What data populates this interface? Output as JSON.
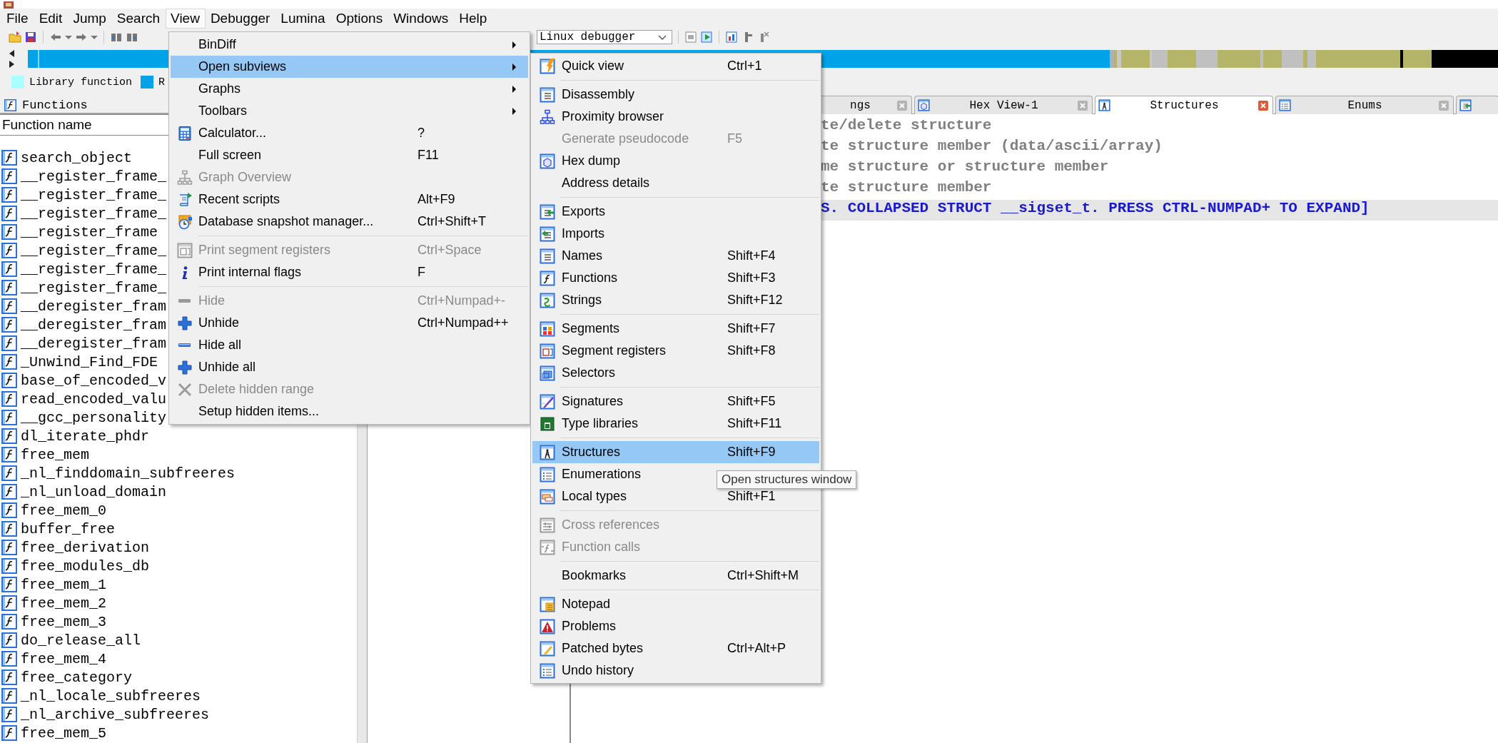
{
  "menu_bar": [
    {
      "label": "File",
      "selected": false
    },
    {
      "label": "Edit",
      "selected": false
    },
    {
      "label": "Jump",
      "selected": false
    },
    {
      "label": "Search",
      "selected": false
    },
    {
      "label": "View",
      "selected": true
    },
    {
      "label": "Debugger",
      "selected": false
    },
    {
      "label": "Lumina",
      "selected": false
    },
    {
      "label": "Options",
      "selected": false
    },
    {
      "label": "Windows",
      "selected": false
    },
    {
      "label": "Help",
      "selected": false
    }
  ],
  "toolbar": {
    "debugger": "Linux debugger"
  },
  "legend": [
    {
      "label": "Library function",
      "color": "#aaffff"
    },
    {
      "label": "R",
      "color": "#00a2e8"
    }
  ],
  "functions_panel": {
    "title": "Functions",
    "column": "Function name",
    "rows": [
      "search_object",
      "__register_frame_",
      "__register_frame_",
      "__register_frame_",
      "__register_frame",
      "__register_frame_",
      "__register_frame_",
      "__register_frame_",
      "__deregister_fram",
      "__deregister_fram",
      "__deregister_fram",
      "_Unwind_Find_FDE",
      "base_of_encoded_v",
      "read_encoded_valu",
      "__gcc_personality",
      "dl_iterate_phdr",
      "free_mem",
      "_nl_finddomain_subfreeres",
      "_nl_unload_domain",
      "free_mem_0",
      "buffer_free",
      "free_derivation",
      "free_modules_db",
      "free_mem_1",
      "free_mem_2",
      "free_mem_3",
      "do_release_all",
      "free_mem_4",
      "free_category",
      "_nl_locale_subfreeres",
      "_nl_archive_subfreeres",
      "free_mem_5"
    ]
  },
  "structures_view": {
    "tabs": [
      {
        "kind": "tab",
        "label": "ngs",
        "selected": false
      },
      {
        "kind": "tab",
        "label": "Hex View-1",
        "selected": false
      },
      {
        "kind": "tab",
        "label": "Structures",
        "selected": true
      },
      {
        "kind": "tab",
        "label": "Enums",
        "selected": false
      },
      {
        "kind": "icon_only",
        "selected": false
      }
    ],
    "lines": [
      {
        "kind": "comment",
        "text": "te/delete structure",
        "selected": false
      },
      {
        "kind": "comment",
        "text": "te structure member (data/ascii/array)",
        "selected": false
      },
      {
        "kind": "comment",
        "text": "me structure or structure member",
        "selected": false
      },
      {
        "kind": "comment",
        "text": "te structure member",
        "selected": false
      },
      {
        "kind": "collapsed",
        "text": "S. COLLAPSED STRUCT __sigset_t. PRESS CTRL-NUMPAD+ TO EXPAND]",
        "selected": true
      }
    ]
  },
  "view_menu": {
    "items": [
      {
        "kind": "item",
        "label": "BinDiff",
        "disabled": false,
        "selected": false,
        "submenu": true
      },
      {
        "kind": "item",
        "label": "Open subviews",
        "disabled": false,
        "selected": true,
        "submenu": true
      },
      {
        "kind": "item",
        "label": "Graphs",
        "disabled": false,
        "selected": false,
        "submenu": true
      },
      {
        "kind": "item",
        "label": "Toolbars",
        "disabled": false,
        "selected": false,
        "submenu": true
      },
      {
        "kind": "item",
        "label": "Calculator...",
        "shortcut": "?",
        "disabled": false,
        "selected": false,
        "submenu": false
      },
      {
        "kind": "item",
        "label": "Full screen",
        "shortcut": "F11",
        "disabled": false,
        "selected": false,
        "submenu": false
      },
      {
        "kind": "item",
        "label": "Graph Overview",
        "disabled": true,
        "selected": false,
        "submenu": false
      },
      {
        "kind": "item",
        "label": "Recent scripts",
        "shortcut": "Alt+F9",
        "disabled": false,
        "selected": false,
        "submenu": false
      },
      {
        "kind": "item",
        "label": "Database snapshot manager...",
        "shortcut": "Ctrl+Shift+T",
        "disabled": false,
        "selected": false,
        "submenu": false
      },
      {
        "kind": "separator"
      },
      {
        "kind": "item",
        "label": "Print segment registers",
        "shortcut": "Ctrl+Space",
        "disabled": true,
        "selected": false,
        "submenu": false
      },
      {
        "kind": "item",
        "label": "Print internal flags",
        "shortcut": "F",
        "disabled": false,
        "selected": false,
        "submenu": false
      },
      {
        "kind": "separator"
      },
      {
        "kind": "item",
        "label": "Hide",
        "shortcut": "Ctrl+Numpad+-",
        "disabled": true,
        "selected": false,
        "submenu": false
      },
      {
        "kind": "item",
        "label": "Unhide",
        "shortcut": "Ctrl+Numpad++",
        "disabled": false,
        "selected": false,
        "submenu": false
      },
      {
        "kind": "item",
        "label": "Hide all",
        "disabled": false,
        "selected": false,
        "submenu": false
      },
      {
        "kind": "item",
        "label": "Unhide all",
        "disabled": false,
        "selected": false,
        "submenu": false
      },
      {
        "kind": "item",
        "label": "Delete hidden range",
        "disabled": true,
        "selected": false,
        "submenu": false
      },
      {
        "kind": "item",
        "label": "Setup hidden items...",
        "disabled": false,
        "selected": false,
        "submenu": false
      }
    ]
  },
  "subviews_menu": {
    "items": [
      {
        "kind": "item",
        "label": "Quick view",
        "shortcut": "Ctrl+1",
        "disabled": false,
        "selected": false
      },
      {
        "kind": "separator"
      },
      {
        "kind": "item",
        "label": "Disassembly",
        "disabled": false,
        "selected": false
      },
      {
        "kind": "item",
        "label": "Proximity browser",
        "disabled": false,
        "selected": false
      },
      {
        "kind": "item",
        "label": "Generate pseudocode",
        "shortcut": "F5",
        "disabled": true,
        "selected": false
      },
      {
        "kind": "item",
        "label": "Hex dump",
        "disabled": false,
        "selected": false
      },
      {
        "kind": "item",
        "label": "Address details",
        "disabled": false,
        "selected": false
      },
      {
        "kind": "separator"
      },
      {
        "kind": "item",
        "label": "Exports",
        "disabled": false,
        "selected": false
      },
      {
        "kind": "item",
        "label": "Imports",
        "disabled": false,
        "selected": false
      },
      {
        "kind": "item",
        "label": "Names",
        "shortcut": "Shift+F4",
        "disabled": false,
        "selected": false
      },
      {
        "kind": "item",
        "label": "Functions",
        "shortcut": "Shift+F3",
        "disabled": false,
        "selected": false
      },
      {
        "kind": "item",
        "label": "Strings",
        "shortcut": "Shift+F12",
        "disabled": false,
        "selected": false
      },
      {
        "kind": "separator"
      },
      {
        "kind": "item",
        "label": "Segments",
        "shortcut": "Shift+F7",
        "disabled": false,
        "selected": false
      },
      {
        "kind": "item",
        "label": "Segment registers",
        "shortcut": "Shift+F8",
        "disabled": false,
        "selected": false
      },
      {
        "kind": "item",
        "label": "Selectors",
        "disabled": false,
        "selected": false
      },
      {
        "kind": "separator"
      },
      {
        "kind": "item",
        "label": "Signatures",
        "shortcut": "Shift+F5",
        "disabled": false,
        "selected": false
      },
      {
        "kind": "item",
        "label": "Type libraries",
        "shortcut": "Shift+F11",
        "disabled": false,
        "selected": false
      },
      {
        "kind": "separator"
      },
      {
        "kind": "item",
        "label": "Structures",
        "shortcut": "Shift+F9",
        "disabled": false,
        "selected": true
      },
      {
        "kind": "item",
        "label": "Enumerations",
        "disabled": false,
        "selected": false
      },
      {
        "kind": "item",
        "label": "Local types",
        "shortcut": "Shift+F1",
        "disabled": false,
        "selected": false
      },
      {
        "kind": "separator"
      },
      {
        "kind": "item",
        "label": "Cross references",
        "disabled": true,
        "selected": false
      },
      {
        "kind": "item",
        "label": "Function calls",
        "disabled": true,
        "selected": false
      },
      {
        "kind": "separator"
      },
      {
        "kind": "item",
        "label": "Bookmarks",
        "shortcut": "Ctrl+Shift+M",
        "disabled": false,
        "selected": false
      },
      {
        "kind": "separator"
      },
      {
        "kind": "item",
        "label": "Notepad",
        "disabled": false,
        "selected": false
      },
      {
        "kind": "item",
        "label": "Problems",
        "disabled": false,
        "selected": false
      },
      {
        "kind": "item",
        "label": "Patched bytes",
        "shortcut": "Ctrl+Alt+P",
        "disabled": false,
        "selected": false
      },
      {
        "kind": "item",
        "label": "Undo history",
        "disabled": false,
        "selected": false
      }
    ]
  },
  "tooltip": "Open structures window"
}
